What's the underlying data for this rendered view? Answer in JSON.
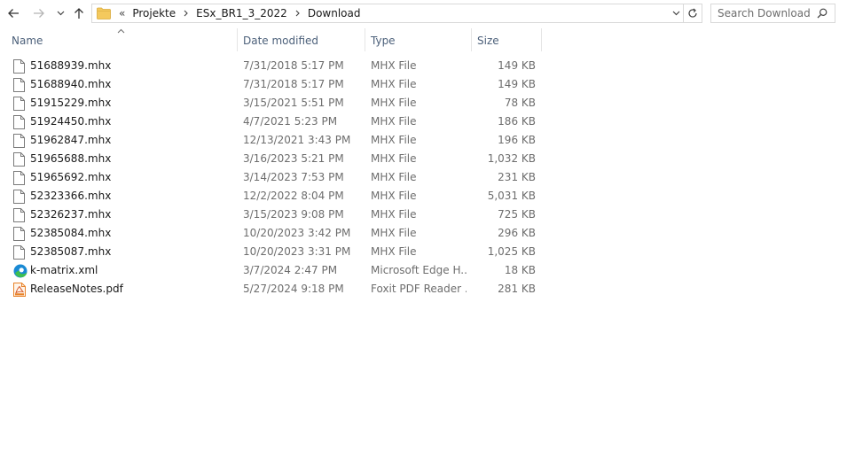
{
  "navigation": {
    "back_tooltip": "Back",
    "forward_tooltip": "Forward",
    "recent_tooltip": "Recent locations",
    "up_tooltip": "Up"
  },
  "address_bar": {
    "overflow": "«",
    "crumbs": [
      "Projekte",
      "ESx_BR1_3_2022",
      "Download"
    ]
  },
  "search": {
    "placeholder": "Search Download"
  },
  "columns": {
    "name": "Name",
    "date_modified": "Date modified",
    "type": "Type",
    "size": "Size",
    "sorted_by": "Name",
    "sort_direction": "ascending"
  },
  "icons": {
    "generic_file": "file-icon",
    "edge_html": "edge-icon",
    "foxit_pdf": "pdf-icon"
  },
  "colors": {
    "header_text": "#4c607a",
    "secondary_text": "#6d6d6d",
    "folder": "#f4c95d",
    "edge_blue": "#1a8ad4",
    "edge_green": "#3fbf4f",
    "pdf_orange": "#e8832a"
  },
  "files": [
    {
      "name": "51688939.mhx",
      "date": "7/31/2018 5:17 PM",
      "type": "MHX File",
      "size": "149 KB",
      "icon": "file-icon"
    },
    {
      "name": "51688940.mhx",
      "date": "7/31/2018 5:17 PM",
      "type": "MHX File",
      "size": "149 KB",
      "icon": "file-icon"
    },
    {
      "name": "51915229.mhx",
      "date": "3/15/2021 5:51 PM",
      "type": "MHX File",
      "size": "78 KB",
      "icon": "file-icon"
    },
    {
      "name": "51924450.mhx",
      "date": "4/7/2021 5:23 PM",
      "type": "MHX File",
      "size": "186 KB",
      "icon": "file-icon"
    },
    {
      "name": "51962847.mhx",
      "date": "12/13/2021 3:43 PM",
      "type": "MHX File",
      "size": "196 KB",
      "icon": "file-icon"
    },
    {
      "name": "51965688.mhx",
      "date": "3/16/2023 5:21 PM",
      "type": "MHX File",
      "size": "1,032 KB",
      "icon": "file-icon"
    },
    {
      "name": "51965692.mhx",
      "date": "3/14/2023 7:53 PM",
      "type": "MHX File",
      "size": "231 KB",
      "icon": "file-icon"
    },
    {
      "name": "52323366.mhx",
      "date": "12/2/2022 8:04 PM",
      "type": "MHX File",
      "size": "5,031 KB",
      "icon": "file-icon"
    },
    {
      "name": "52326237.mhx",
      "date": "3/15/2023 9:08 PM",
      "type": "MHX File",
      "size": "725 KB",
      "icon": "file-icon"
    },
    {
      "name": "52385084.mhx",
      "date": "10/20/2023 3:42 PM",
      "type": "MHX File",
      "size": "296 KB",
      "icon": "file-icon"
    },
    {
      "name": "52385087.mhx",
      "date": "10/20/2023 3:31 PM",
      "type": "MHX File",
      "size": "1,025 KB",
      "icon": "file-icon"
    },
    {
      "name": "k-matrix.xml",
      "date": "3/7/2024 2:47 PM",
      "type": "Microsoft Edge H...",
      "size": "18 KB",
      "icon": "edge-icon"
    },
    {
      "name": "ReleaseNotes.pdf",
      "date": "5/27/2024 9:18 PM",
      "type": "Foxit PDF Reader ...",
      "size": "281 KB",
      "icon": "pdf-icon"
    }
  ]
}
